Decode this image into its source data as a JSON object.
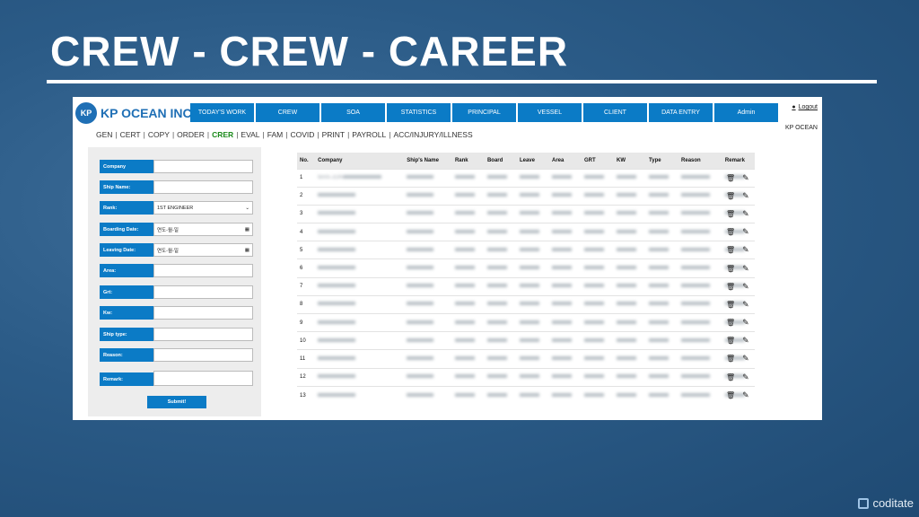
{
  "slide": {
    "title": "CREW - CREW - CAREER",
    "brand": "coditate"
  },
  "app": {
    "logo_badge": "KP",
    "logo_text": "KP OCEAN INC",
    "topnav": [
      "TODAY'S WORK",
      "CREW",
      "SOA",
      "STATISTICS",
      "PRINCIPAL",
      "VESSEL",
      "CLIENT",
      "DATA ENTRY",
      "Admin"
    ],
    "logout": "Logout",
    "company": "KP OCEAN",
    "subnav": [
      "GEN",
      "CERT",
      "COPY",
      "ORDER",
      "CRER",
      "EVAL",
      "FAM",
      "COVID",
      "PRINT",
      "PAYROLL",
      "ACC/INJURY/ILLNESS"
    ],
    "subnav_active": "CRER"
  },
  "form": {
    "fields": [
      {
        "label": "Company",
        "value": ""
      },
      {
        "label": "Ship Name:",
        "value": ""
      },
      {
        "label": "Rank:",
        "value": "1ST ENGINEER"
      },
      {
        "label": "Boarding Date:",
        "value": "연도-월-일"
      },
      {
        "label": "Leaving Date:",
        "value": "연도-월-일"
      },
      {
        "label": "Area:",
        "value": ""
      },
      {
        "label": "Grt:",
        "value": ""
      },
      {
        "label": "Kw:",
        "value": ""
      },
      {
        "label": "Ship type:",
        "value": ""
      },
      {
        "label": "Reason:",
        "value": ""
      },
      {
        "label": "Remark:",
        "value": ""
      }
    ],
    "submit": "Submit!"
  },
  "table": {
    "headers": [
      "No.",
      "Company",
      "Ship's Name",
      "Rank",
      "Board",
      "Leave",
      "Area",
      "GRT",
      "KW",
      "Type",
      "Reason",
      "Remark"
    ],
    "rows": [
      [
        "1",
        "MAN-JOIN",
        "",
        "",
        "",
        "",
        "",
        "",
        "",
        "",
        "",
        ""
      ],
      [
        "2",
        "",
        "",
        "",
        "",
        "",
        "",
        "",
        "",
        "",
        "",
        ""
      ],
      [
        "3",
        "",
        "",
        "",
        "",
        "",
        "",
        "",
        "",
        "",
        "",
        ""
      ],
      [
        "4",
        "",
        "",
        "",
        "",
        "",
        "",
        "",
        "",
        "",
        "",
        ""
      ],
      [
        "5",
        "",
        "",
        "",
        "",
        "",
        "",
        "",
        "",
        "",
        "",
        ""
      ],
      [
        "6",
        "",
        "",
        "",
        "",
        "",
        "",
        "",
        "",
        "",
        "",
        ""
      ],
      [
        "7",
        "",
        "",
        "",
        "",
        "",
        "",
        "",
        "",
        "",
        "",
        ""
      ],
      [
        "8",
        "",
        "",
        "",
        "",
        "",
        "",
        "",
        "",
        "",
        "",
        ""
      ],
      [
        "9",
        "",
        "",
        "",
        "",
        "",
        "",
        "",
        "",
        "",
        "",
        ""
      ],
      [
        "10",
        "",
        "",
        "",
        "",
        "",
        "",
        "",
        "",
        "",
        "",
        ""
      ],
      [
        "11",
        "",
        "",
        "",
        "",
        "",
        "",
        "",
        "",
        "",
        "",
        ""
      ],
      [
        "12",
        "",
        "",
        "",
        "",
        "",
        "",
        "",
        "",
        "",
        "",
        ""
      ],
      [
        "13",
        "",
        "",
        "",
        "",
        "",
        "",
        "",
        "",
        "",
        "",
        ""
      ]
    ]
  },
  "colors": {
    "accent": "#0b7bc6",
    "active_tab": "#1a8a1a"
  }
}
